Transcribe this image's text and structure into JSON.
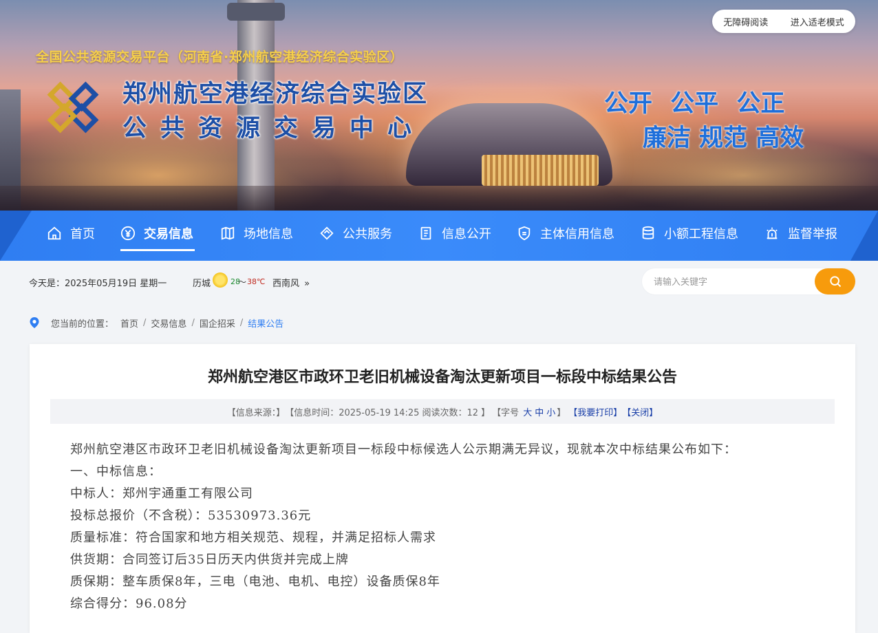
{
  "header": {
    "accessibility_read": "无障碍阅读",
    "elder_mode": "进入适老模式",
    "platform_title": "全国公共资源交易平台（河南省·郑州航空港经济综合实验区）",
    "brand_line1": "郑州航空港经济综合实验区",
    "brand_line2": "公共资源交易中心",
    "slogan_line1": "公开 公平 公正",
    "slogan_line2": "廉洁 规范 高效"
  },
  "nav": {
    "items": [
      {
        "label": "首页",
        "icon": "home-icon"
      },
      {
        "label": "交易信息",
        "icon": "yen-icon",
        "active": true
      },
      {
        "label": "场地信息",
        "icon": "map-icon"
      },
      {
        "label": "公共服务",
        "icon": "diamond-icon"
      },
      {
        "label": "信息公开",
        "icon": "document-icon"
      },
      {
        "label": "主体信用信息",
        "icon": "credit-shield-icon"
      },
      {
        "label": "小额工程信息",
        "icon": "database-icon"
      },
      {
        "label": "监督举报",
        "icon": "alarm-icon"
      }
    ]
  },
  "info_bar": {
    "date_text": "今天是：2025年05月19日 星期一",
    "weather": {
      "city": "历城",
      "temp_low": "28",
      "temp_sep": "～",
      "temp_high": "38℃",
      "wind": "西南风",
      "icon": "sunny-icon",
      "low_color": "#1a8a2e",
      "high_color": "#c0281d"
    },
    "search": {
      "placeholder": "请输入关键字"
    }
  },
  "breadcrumb": {
    "prefix": "您当前的位置：",
    "items": [
      "首页",
      "交易信息",
      "国企招采",
      "结果公告"
    ]
  },
  "article": {
    "title": "郑州航空港区市政环卫老旧机械设备淘汰更新项目一标段中标结果公告",
    "meta": {
      "source": "【信息来源：】",
      "time": "【信息时间：2025-05-19 14:25 阅读次数：12 】",
      "font_size_label": "【字号",
      "size_large": "大",
      "size_medium": "中",
      "size_small": "小",
      "font_size_end": "】",
      "print": "【我要打印】",
      "close": "【关闭】"
    },
    "paragraphs": [
      "郑州航空港区市政环卫老旧机械设备淘汰更新项目一标段中标候选人公示期满无异议，现就本次中标结果公布如下：",
      "一、中标信息：",
      "中标人：郑州宇通重工有限公司",
      "投标总报价（不含税）：53530973.36元",
      "质量标准：符合国家和地方相关规范、规程，并满足招标人需求",
      "供货期：合同签订后35日历天内供货并完成上牌",
      "质保期：整车质保8年，三电（电池、电机、电控）设备质保8年",
      "综合得分：96.08分"
    ]
  },
  "colors": {
    "nav_blue": "#2f7ef2",
    "accent_orange": "#f79b0c",
    "brand_blue": "#1d4fa6",
    "platform_gold": "#f6d04a",
    "link_blue": "#1a3fa8"
  }
}
